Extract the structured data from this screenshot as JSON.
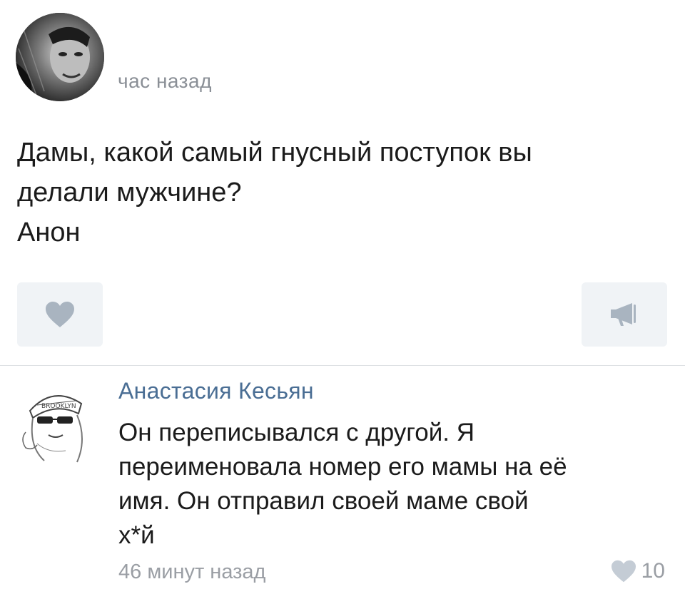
{
  "post": {
    "time": "час назад",
    "lines": [
      "Дамы, какой самый гнусный поступок вы",
      "делали мужчине?",
      "Анон"
    ]
  },
  "actions": {
    "like_icon": "heart-icon",
    "share_icon": "megaphone-icon"
  },
  "comment": {
    "author": "Анастасия Кесьян",
    "lines": [
      "Он переписывался с другой. Я",
      "переименовала номер его мамы на её",
      "имя. Он отправил своей маме свой",
      "х*й"
    ],
    "time": "46 минут назад",
    "likes": "10"
  },
  "colors": {
    "author_link": "#4a6e94",
    "muted_text": "#8a8f96",
    "button_bg": "#f0f3f6",
    "icon_gray": "#a9b4c0"
  }
}
